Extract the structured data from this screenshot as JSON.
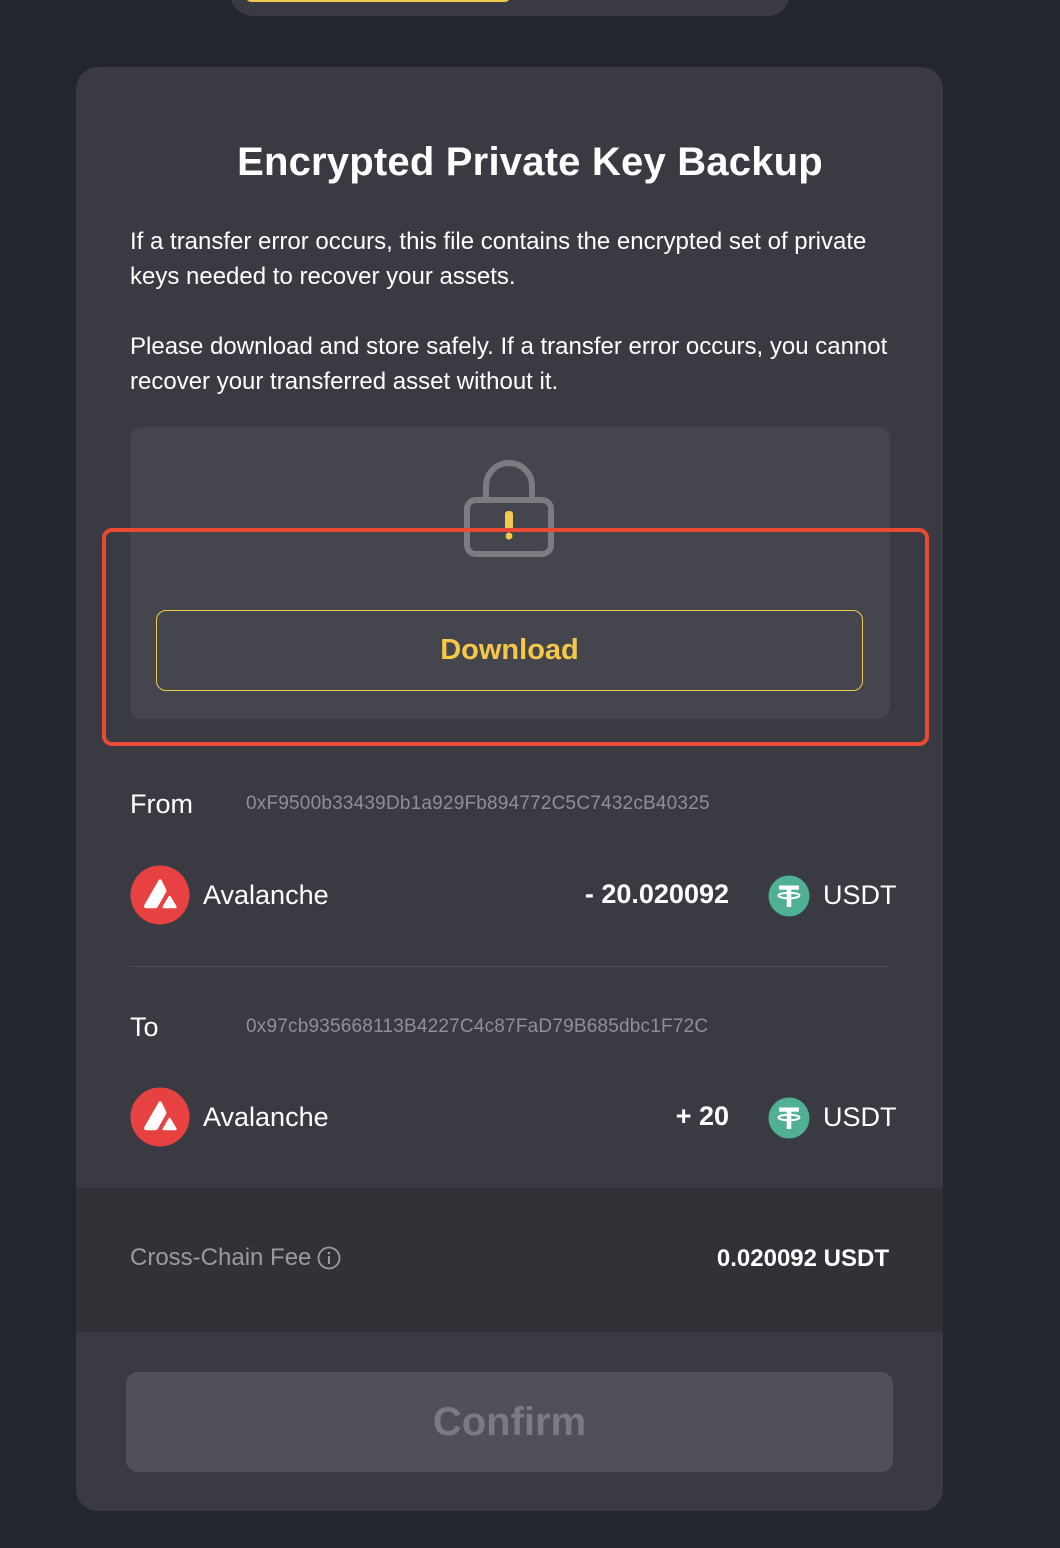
{
  "colors": {
    "accent": "#f2c94c",
    "highlight": "#e84a35",
    "avalanche": "#e84142",
    "usdt": "#50af95"
  },
  "progress": {
    "value_fraction": 0.5
  },
  "backup": {
    "title": "Encrypted Private Key Backup",
    "paragraph1": "If a transfer error occurs, this file contains the encrypted set of private keys needed to recover your assets.",
    "paragraph2": "Please download and store safely. If a transfer error occurs, you cannot recover your transferred asset without it.",
    "lock_icon": "lock-warning-icon",
    "download_label": "Download"
  },
  "from": {
    "label": "From",
    "address": "0xF9500b33439Db1a929Fb894772C5C7432cB40325",
    "chain": "Avalanche",
    "chain_icon": "avalanche-icon",
    "amount": "- 20.020092",
    "token": "USDT",
    "token_icon": "usdt-icon"
  },
  "to": {
    "label": "To",
    "address": "0x97cb935668113B4227C4c87FaD79B685dbc1F72C",
    "chain": "Avalanche",
    "chain_icon": "avalanche-icon",
    "amount": "+ 20",
    "token": "USDT",
    "token_icon": "usdt-icon"
  },
  "fee": {
    "label": "Cross-Chain Fee",
    "info_icon": "info-icon",
    "value": "0.020092 USDT"
  },
  "confirm": {
    "label": "Confirm"
  }
}
